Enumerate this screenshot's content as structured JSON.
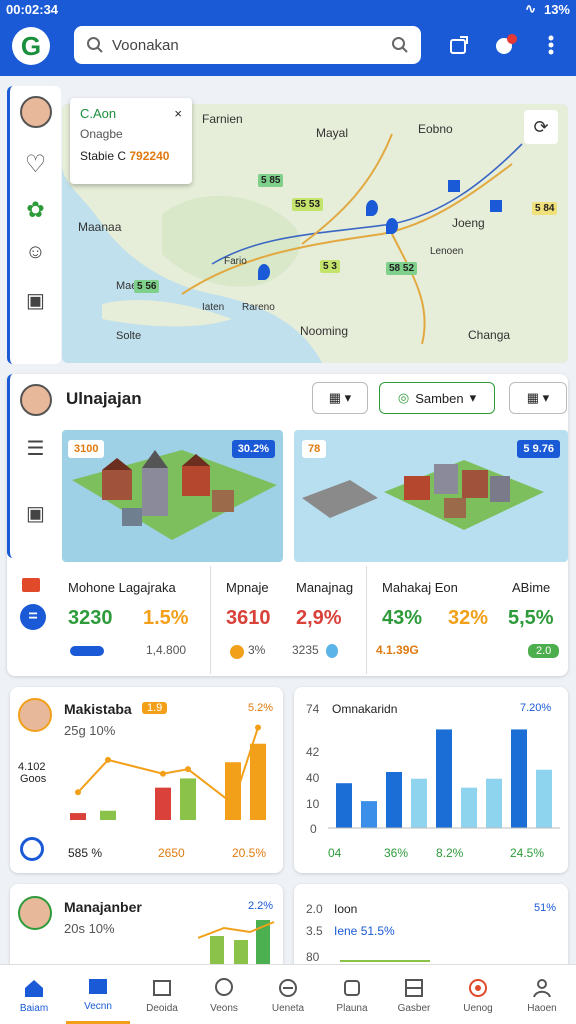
{
  "status": {
    "time": "00:02:34",
    "battery": "13%"
  },
  "search": {
    "placeholder": "Voonakan"
  },
  "map": {
    "popup": {
      "title": "C.Aon",
      "line2": "Onagbe",
      "line3_label": "Stabie C",
      "line3_value": "792240"
    },
    "labels": [
      "Farnien",
      "Mayal",
      "Eobno",
      "Maanaa",
      "Fario",
      "Lenoen",
      "Joeng",
      "Maeno",
      "Iaten",
      "Rareno",
      "Solte",
      "Nooming",
      "Changa"
    ],
    "tags": [
      "55 53",
      "5 84",
      "5 3",
      "58 52",
      "5 56",
      "5 85"
    ]
  },
  "section": {
    "title": "Ulnajajan",
    "select_label": "Samben"
  },
  "tiles": [
    {
      "badge_left": "3100",
      "badge_right": "30.2%"
    },
    {
      "badge_left": "78",
      "badge_right": "5 9.76"
    }
  ],
  "stats": [
    {
      "label": "Mohone Lagajraka",
      "value1": "3230",
      "value2": "1.5%",
      "sub": "1,4.800"
    },
    {
      "label": "Mpnaje",
      "value": "3610",
      "sub": "3%"
    },
    {
      "label": "Manajnag",
      "value": "2,9%",
      "sub": "3235"
    },
    {
      "label": "Mahakaj Eon",
      "value": "43%",
      "value2": "32%",
      "sub": "4.1.39G"
    },
    {
      "label": "ABime",
      "value": "5,5%",
      "sub": "2.0"
    }
  ],
  "chart1": {
    "title": "Makistaba",
    "badge": "1.9",
    "right": "5.2%",
    "sub": "25g 10%",
    "ylabel": "4.102",
    "ylabel2": "Goos",
    "foot1": "585 %",
    "foot2": "2650",
    "foot3": "20.5%"
  },
  "chart2": {
    "title": "Omnakaridn",
    "right": "7.20%",
    "yticks": [
      "74",
      "42",
      "40",
      "10",
      "0"
    ],
    "foot": [
      "04",
      "36%",
      "8.2%",
      "24.5%"
    ]
  },
  "chart_data": [
    {
      "type": "bar",
      "title": "Makistaba",
      "values": [
        3,
        4,
        14,
        18,
        25,
        33
      ],
      "line": [
        12,
        26,
        20,
        22,
        7,
        40
      ]
    },
    {
      "type": "bar",
      "title": "Omnakaridn",
      "yticks": [
        "74",
        "42",
        "40",
        "10",
        "0"
      ],
      "values": [
        20,
        12,
        25,
        22,
        44,
        18,
        22,
        44,
        26
      ]
    }
  ],
  "card3": {
    "title": "Manajanber",
    "sub": "20s 10%",
    "badge": "2.2%"
  },
  "card4": {
    "t1": "2.0",
    "t2": "Ioon",
    "t3": "3.5",
    "t4": "Iene 51.5%",
    "t5": "80",
    "right": "51%"
  },
  "nav": [
    "Baiam",
    "Vecnn",
    "Deoida",
    "Veons",
    "Ueneta",
    "Plauna",
    "Gasber",
    "Uenog",
    "Haoen"
  ],
  "colors": {
    "primary": "#1a5ad6",
    "green": "#2e9b3a",
    "orange": "#f2a019",
    "red": "#d9413a"
  }
}
